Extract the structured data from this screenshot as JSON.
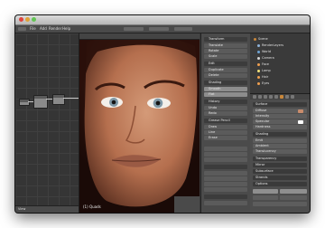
{
  "window": {
    "title": ""
  },
  "menubar": {
    "items": [
      "File",
      "Add",
      "Render",
      "Help"
    ]
  },
  "node_editor": {
    "footer_label": "View",
    "nodes": [
      "input",
      "material",
      "output"
    ]
  },
  "viewport": {
    "label": "(1) Quads"
  },
  "tool_panel": {
    "rows": [
      "Transform",
      "Translate",
      "Rotate",
      "Scale",
      "Edit",
      "Duplicate",
      "Delete",
      "Shading",
      "Smooth",
      "Flat",
      "History",
      "Undo",
      "Redo",
      "Grease Pencil",
      "Draw",
      "Line",
      "Erase"
    ]
  },
  "outliner": {
    "items": [
      "Scene",
      "RenderLayers",
      "World",
      "Camera",
      "Face",
      "Lamp",
      "Hair",
      "Eyes"
    ]
  },
  "properties": {
    "rows": [
      "Surface",
      "Diffuse",
      "Intensity",
      "Specular",
      "Hardness",
      "Shading",
      "Emit",
      "Ambient",
      "Translucency",
      "Transparency",
      "Mirror",
      "Subsurface",
      "Strands",
      "Options"
    ],
    "accent": "#c9873a"
  }
}
